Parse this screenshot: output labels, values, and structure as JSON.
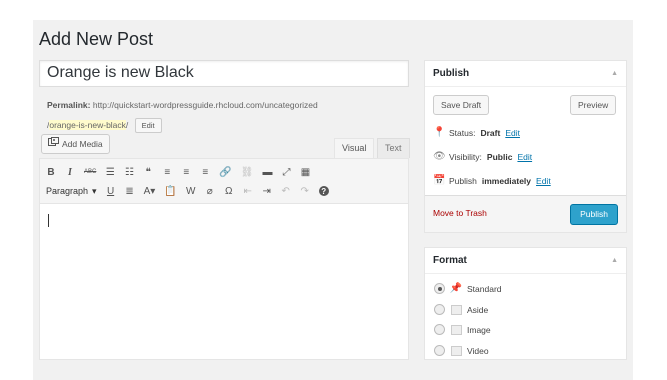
{
  "page": {
    "title": "Add New Post"
  },
  "post": {
    "title": "Orange is new Black",
    "permalink_label": "Permalink:",
    "permalink_base": "http://quickstart-wordpressguide.rhcloud.com/uncategorized",
    "permalink_prefix": "/",
    "permalink_slug": "orange-is-new-black",
    "permalink_suffix": "/",
    "permalink_edit": "Edit"
  },
  "editor": {
    "add_media": "Add Media",
    "tabs": {
      "visual": "Visual",
      "text": "Text"
    },
    "format_select": "Paragraph",
    "toolbar_row1": [
      {
        "name": "bold-button",
        "glyph": "B"
      },
      {
        "name": "italic-button",
        "glyph": "I"
      },
      {
        "name": "strikethrough-button",
        "glyph": "ABC"
      },
      {
        "name": "bullet-list-button",
        "glyph": "☰"
      },
      {
        "name": "numbered-list-button",
        "glyph": "☷"
      },
      {
        "name": "blockquote-button",
        "glyph": "❝"
      },
      {
        "name": "align-left-button",
        "glyph": "≡"
      },
      {
        "name": "align-center-button",
        "glyph": "≡"
      },
      {
        "name": "align-right-button",
        "glyph": "≡"
      },
      {
        "name": "insert-link-button",
        "glyph": "🔗"
      },
      {
        "name": "remove-link-button",
        "glyph": "⛓"
      },
      {
        "name": "read-more-button",
        "glyph": "▬"
      },
      {
        "name": "fullscreen-button",
        "glyph": "⤢"
      },
      {
        "name": "toolbar-toggle-button",
        "glyph": "▦"
      }
    ],
    "toolbar_row2": [
      {
        "name": "underline-button",
        "glyph": "U"
      },
      {
        "name": "justify-button",
        "glyph": "≣"
      },
      {
        "name": "text-color-button",
        "glyph": "A▾"
      },
      {
        "name": "paste-text-button",
        "glyph": "📋"
      },
      {
        "name": "paste-word-button",
        "glyph": "W"
      },
      {
        "name": "clear-formatting-button",
        "glyph": "⌀"
      },
      {
        "name": "special-character-button",
        "glyph": "Ω"
      },
      {
        "name": "outdent-button",
        "glyph": "⇤"
      },
      {
        "name": "indent-button",
        "glyph": "⇥"
      },
      {
        "name": "undo-button",
        "glyph": "↶"
      },
      {
        "name": "redo-button",
        "glyph": "↷"
      },
      {
        "name": "help-button",
        "glyph": "?"
      }
    ]
  },
  "publish": {
    "title": "Publish",
    "save_draft": "Save Draft",
    "preview": "Preview",
    "status_label": "Status:",
    "status_value": "Draft",
    "visibility_label": "Visibility:",
    "visibility_value": "Public",
    "schedule_label": "Publish",
    "schedule_value": "immediately",
    "edit_link": "Edit",
    "trash": "Move to Trash",
    "publish_button": "Publish"
  },
  "format": {
    "title": "Format",
    "options": [
      {
        "label": "Standard",
        "icon": "pin-icon",
        "checked": true
      },
      {
        "label": "Aside",
        "icon": "aside-icon",
        "checked": false
      },
      {
        "label": "Image",
        "icon": "image-icon",
        "checked": false
      },
      {
        "label": "Video",
        "icon": "video-icon",
        "checked": false
      }
    ]
  },
  "colors": {
    "primary": "#2ea2cc",
    "link": "#0073aa",
    "danger": "#aa0000",
    "slug_highlight": "#fffbcc"
  }
}
